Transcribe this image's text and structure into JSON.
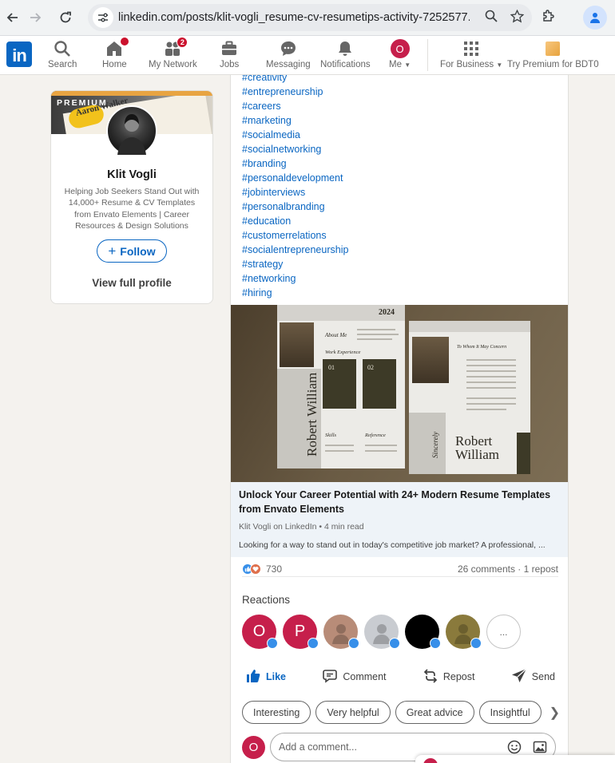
{
  "browser": {
    "url": "linkedin.com/posts/klit-vogli_resume-cv-resumetips-activity-7252577..."
  },
  "header": {
    "nav": [
      {
        "label": "Search",
        "icon": "search-icon"
      },
      {
        "label": "Home",
        "icon": "home-icon",
        "badge": ""
      },
      {
        "label": "My Network",
        "icon": "network-icon",
        "badge": "2"
      },
      {
        "label": "Jobs",
        "icon": "briefcase-icon"
      },
      {
        "label": "Messaging",
        "icon": "messaging-icon"
      },
      {
        "label": "Notifications",
        "icon": "bell-icon"
      },
      {
        "label": "Me",
        "avatar_letter": "O"
      },
      {
        "label": "For Business",
        "icon": "grid-icon"
      },
      {
        "label": "Try Premium for BDT0",
        "icon": "premium-icon"
      }
    ],
    "accent": "#0a66c2",
    "badge_color": "#cb112d"
  },
  "profile_card": {
    "banner_text": "PREMIUM",
    "banner_name": "Aaron Walker",
    "name": "Klit Vogli",
    "headline": "Helping Job Seekers Stand Out with 14,000+ Resume & CV Templates from Envato Elements | Career Resources & Design Solutions",
    "follow_label": "Follow",
    "view_profile_label": "View full profile"
  },
  "post": {
    "hashtags": [
      "#creativity",
      "#entrepreneurship",
      "#careers",
      "#marketing",
      "#socialmedia",
      "#socialnetworking",
      "#branding",
      "#personaldevelopment",
      "#jobinterviews",
      "#personalbranding",
      "#education",
      "#customerrelations",
      "#socialentrepreneurship",
      "#strategy",
      "#networking",
      "#hiring"
    ],
    "image_text": {
      "resume_year": "2024",
      "resume_name_1": "Robert William",
      "about_me": "About Me",
      "work_experience": "Work Experience",
      "num1": "01",
      "num2": "02",
      "skills": "Skills",
      "reference": "Reference",
      "letter_title": "To Whom It May Concern",
      "sincerely": "Sincerely",
      "resume_name_2_line1": "Robert",
      "resume_name_2_line2": "William"
    },
    "article": {
      "title": "Unlock Your Career Potential with 24+ Modern Resume Templates from Envato Elements",
      "author": "Klit Vogli on LinkedIn • 4 min read",
      "snippet": "Looking for a way to stand out in today's competitive job market? A professional, ..."
    },
    "reactions_count": "730",
    "comments_reposts": "26 comments · 1 repost",
    "reactions_title": "Reactions",
    "reactors": [
      {
        "letter": "O",
        "color": "#c61f4b"
      },
      {
        "letter": "P",
        "color": "#c61f4b"
      },
      {
        "letter": "",
        "color": "#b88c78"
      },
      {
        "letter": "",
        "color": "#c9ccd1"
      },
      {
        "letter": "",
        "color": "#000000"
      },
      {
        "letter": "",
        "color": "#8a7a3c"
      },
      {
        "letter": "...",
        "color": "#ffffff"
      }
    ],
    "actions": {
      "like": "Like",
      "comment": "Comment",
      "repost": "Repost",
      "send": "Send"
    },
    "suggestions": [
      "Interesting",
      "Very helpful",
      "Great advice",
      "Insightful"
    ],
    "comment_placeholder": "Add a comment...",
    "comment_avatar_letter": "O"
  }
}
